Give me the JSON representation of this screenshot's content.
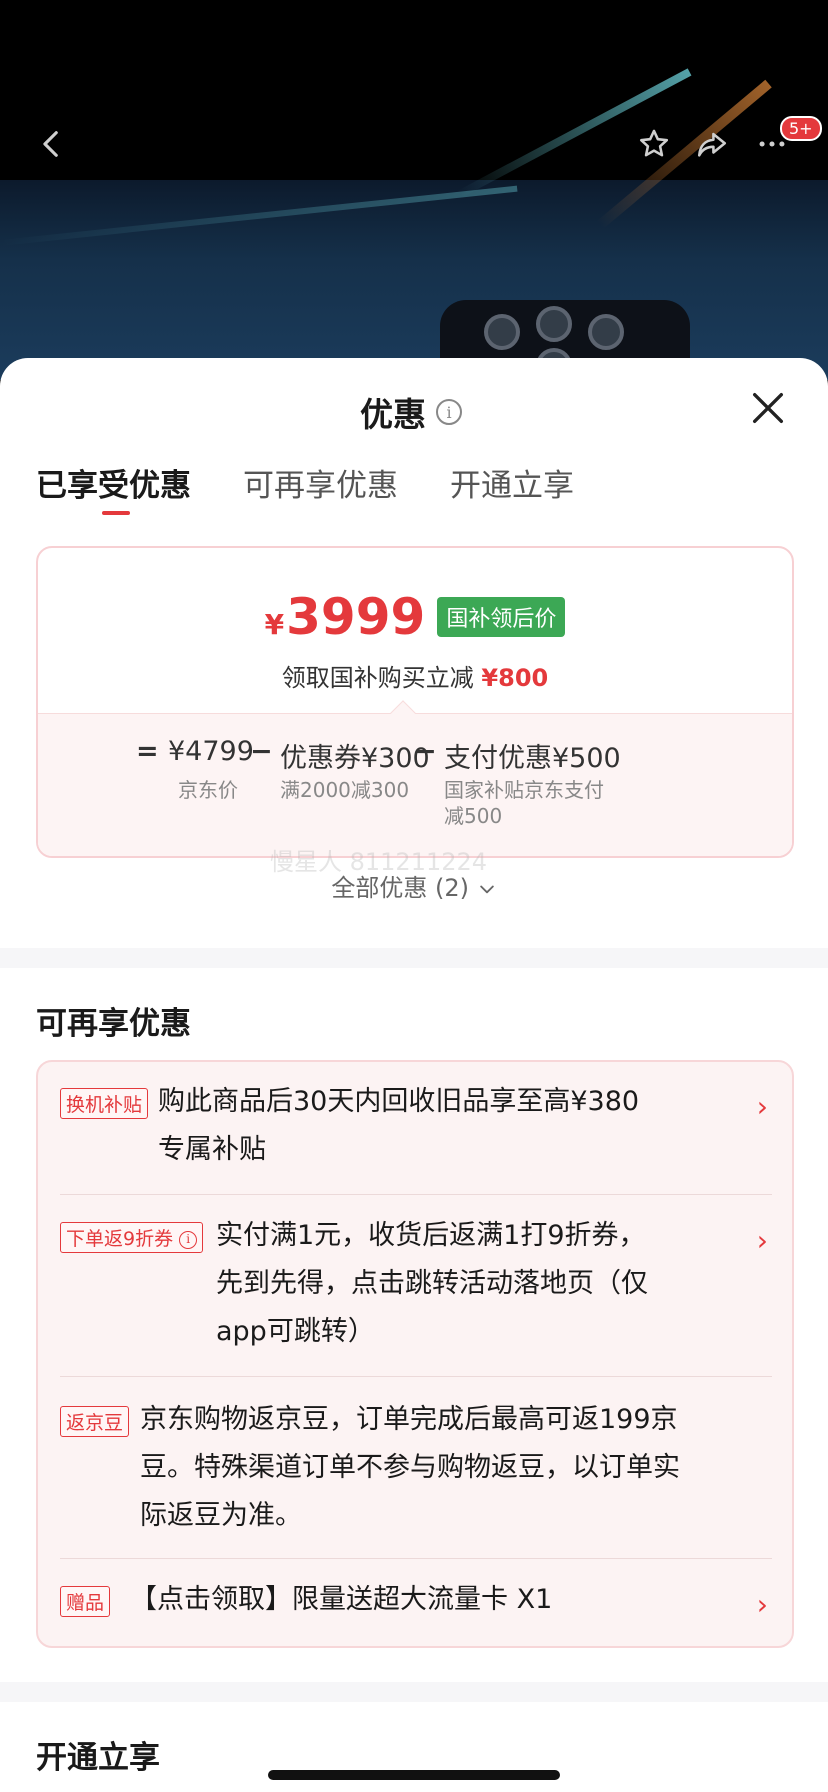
{
  "nav": {
    "cart_badge": "5+"
  },
  "sheet": {
    "title": "优惠",
    "tabs": [
      {
        "label": "已享受优惠",
        "active": true
      },
      {
        "label": "可再享优惠",
        "active": false
      },
      {
        "label": "开通立享",
        "active": false
      }
    ]
  },
  "price_card": {
    "currency": "¥",
    "final_price": "3999",
    "tag": "国补领后价",
    "subtitle_prefix": "领取国补购买立减",
    "subtitle_amount": "¥800",
    "formula": {
      "eq": "=",
      "base_price": "¥4799",
      "base_label": "京东价",
      "minus1": "−",
      "coupon": "优惠券¥300",
      "coupon_label": "满2000减300",
      "minus2": "−",
      "pay_discount": "支付优惠¥500",
      "pay_label_line1": "国家补贴京东支付",
      "pay_label_line2": "减500"
    }
  },
  "watermark": "慢星人 811211224",
  "all_offers": "全部优惠 (2)",
  "more_offers": {
    "title": "可再享优惠",
    "items": [
      {
        "tag": "换机补贴",
        "line1": "购此商品后30天内回收旧品享至高¥380",
        "line2": "专属补贴",
        "line3": "",
        "chevron": true
      },
      {
        "tag": "下单返9折券",
        "line1": "实付满1元，收货后返满1打9折券，",
        "line2": "先到先得，点击跳转活动落地页（仅",
        "line3": "app可跳转）",
        "chevron": true
      },
      {
        "tag": "返京豆",
        "line1": "京东购物返京豆，订单完成后最高可返199京",
        "line2": "豆。特殊渠道订单不参与购物返豆，以订单实",
        "line3": "际返豆为准。",
        "chevron": false
      },
      {
        "tag": "赠品",
        "line1": "【点击领取】限量送超大流量卡 X1",
        "line2": "",
        "line3": "",
        "chevron": true
      }
    ]
  },
  "open_section": {
    "title": "开通立享"
  },
  "colors": {
    "accent": "#e4393c",
    "green_tag": "#3ca855"
  }
}
